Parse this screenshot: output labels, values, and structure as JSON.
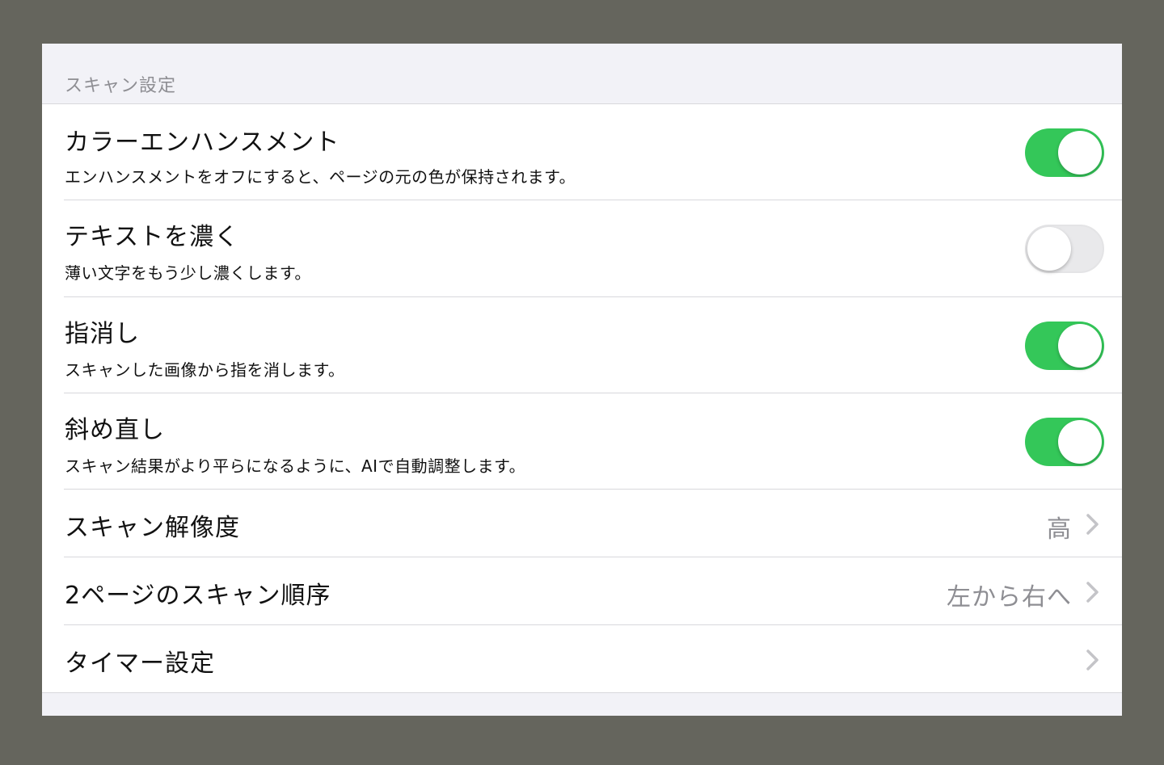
{
  "section": {
    "header": "スキャン設定"
  },
  "rows": {
    "color_enhance": {
      "title": "カラーエンハンスメント",
      "subtitle": "エンハンスメントをオフにすると、ページの元の色が保持されます。",
      "enabled": true
    },
    "darken_text": {
      "title": "テキストを濃く",
      "subtitle": "薄い文字をもう少し濃くします。",
      "enabled": false
    },
    "finger_removal": {
      "title": "指消し",
      "subtitle": "スキャンした画像から指を消します。",
      "enabled": true
    },
    "deskew": {
      "title": "斜め直し",
      "subtitle": "スキャン結果がより平らになるように、AIで自動調整します。",
      "enabled": true
    },
    "resolution": {
      "title": "スキャン解像度",
      "value": "高"
    },
    "two_page_order": {
      "title": "2ページのスキャン順序",
      "value": "左から右へ"
    },
    "timer": {
      "title": "タイマー設定"
    }
  },
  "icons": {
    "chevron": "chevron-right-icon"
  },
  "colors": {
    "toggle_on": "#34c759",
    "toggle_off": "#e9e9eb",
    "secondary_text": "#8e8e93",
    "chevron": "#c4c4c8"
  }
}
